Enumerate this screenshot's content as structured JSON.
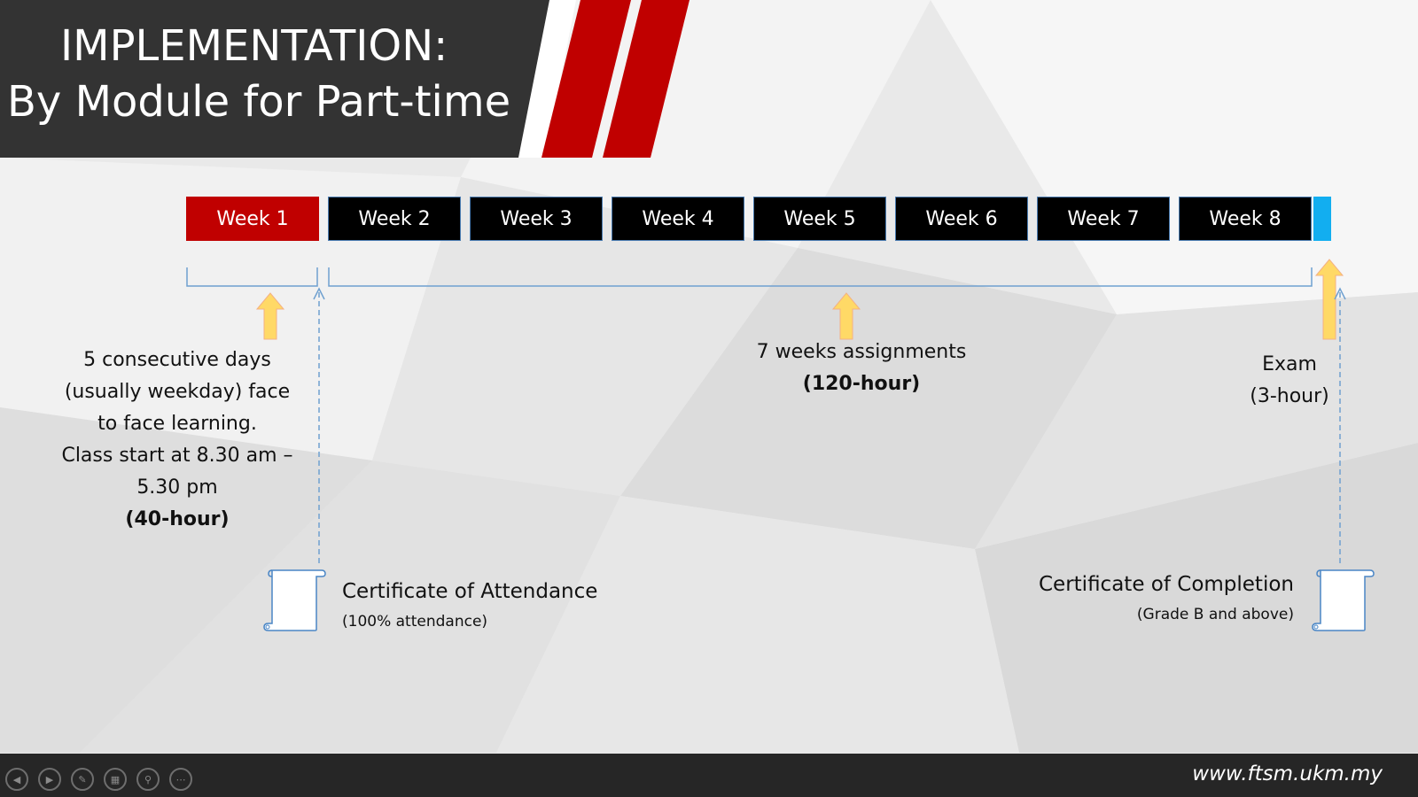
{
  "slide": {
    "title_line1": "IMPLEMENTATION:",
    "title_line2": "By Module for Part-time",
    "colors": {
      "accent_red": "#c00000",
      "week_bg": "#000000",
      "end_marker": "#12aef0",
      "arrow_fill": "#ffd966",
      "bracket_line": "#6fa0d0",
      "footer_bg": "#262626"
    }
  },
  "timeline": {
    "weeks": [
      "Week 1",
      "Week 2",
      "Week 3",
      "Week 4",
      "Week 5",
      "Week 6",
      "Week 7",
      "Week 8"
    ]
  },
  "phases": {
    "face_to_face": {
      "lines": [
        "5 consecutive days",
        "(usually weekday) face",
        "to face learning.",
        "Class start at 8.30 am –",
        "5.30 pm"
      ],
      "hours": "(40-hour)"
    },
    "assignments": {
      "line": "7 weeks assignments",
      "hours": "(120-hour)"
    },
    "exam": {
      "line": "Exam",
      "hours": "(3-hour)"
    }
  },
  "certificates": {
    "attendance": {
      "title": "Certificate of Attendance",
      "subtitle": "(100% attendance)",
      "icon": "scroll-icon"
    },
    "completion": {
      "title": "Certificate of Completion",
      "subtitle": "(Grade B and above)",
      "icon": "scroll-icon"
    }
  },
  "footer": {
    "url": "www.ftsm.ukm.my",
    "controls": [
      "previous-icon",
      "next-icon",
      "pen-icon",
      "slides-grid-icon",
      "zoom-icon",
      "more-icon"
    ]
  }
}
